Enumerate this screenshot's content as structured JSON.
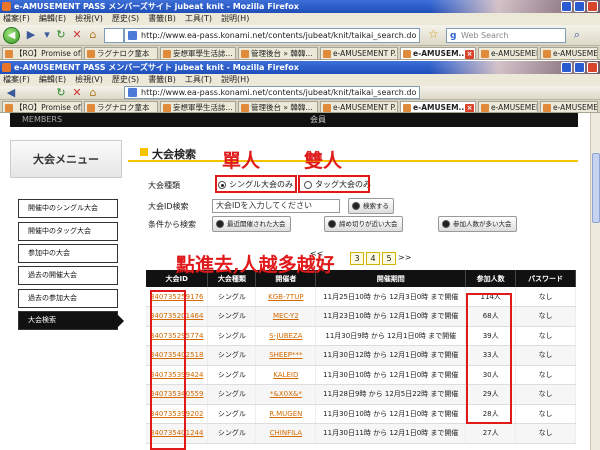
{
  "window": {
    "title": "e-AMUSEMENT PASS メンバーズサイト jubeat knit - Mozilla Firefox",
    "menu": [
      "檔案(F)",
      "編輯(E)",
      "檢視(V)",
      "歷史(S)",
      "書籤(B)",
      "工具(T)",
      "說明(H)"
    ],
    "nav": {
      "favicon_domain": "konami.net",
      "url": "http://www.ea-pass.konami.net/contents/jubeat/knit/taikai_search.do",
      "search_placeholder": "Web Search"
    },
    "tabs": [
      {
        "label": "【RO】Promise of..."
      },
      {
        "label": "ラグナロク童本"
      },
      {
        "label": "妄想軍學生活誌..."
      },
      {
        "label": "管理後台 » 韓韓..."
      },
      {
        "label": "e-AMUSEMENT P..."
      },
      {
        "label": "e-AMUSEM..."
      },
      {
        "label": "e-AMUSEMENT P..."
      },
      {
        "label": "e-AMUSEMENT P..."
      },
      {
        "label": "e-AMUSEMENT..."
      }
    ]
  },
  "window2": {
    "title": "e-AMUSEMENT PASS メンバーズサイト jubeat knit - Mozilla Firefox",
    "menu": [
      "檔案(F)",
      "編輯(E)",
      "檢視(V)",
      "歷史(S)",
      "書籤(B)",
      "工具(T)",
      "說明(H)"
    ],
    "nav": {
      "favicon_domain": "konami.net",
      "url": "http://www.ea-pass.konami.net/contents/jubeat/knit/taikai_search.do"
    },
    "tabs": [
      {
        "label": "【RO】Promise of..."
      },
      {
        "label": "ラグナロク童本"
      },
      {
        "label": "妄想軍學生活誌..."
      },
      {
        "label": "管理後台 » 韓韓..."
      },
      {
        "label": "e-AMUSEMENT P..."
      },
      {
        "label": "e-AMUSEM..."
      },
      {
        "label": "e-AMUSEMENT P..."
      },
      {
        "label": "e-AMUSEMENT P..."
      },
      {
        "label": "e-AMUSEMENT..."
      }
    ]
  },
  "banner_text": "MEMBERS",
  "banner_text2": "会員",
  "sidebar": {
    "heading": "大会メニュー",
    "items": [
      {
        "label": "開催中のシングル大会"
      },
      {
        "label": "開催中のタッグ大会"
      },
      {
        "label": "参加中の大会"
      },
      {
        "label": "過去の開催大会"
      },
      {
        "label": "過去の参加大会"
      },
      {
        "label": "大会検索"
      }
    ]
  },
  "search": {
    "title": "大会検索",
    "type_label": "大会種類",
    "single_option": "シングル大会のみ",
    "tag_option": "タッグ大会のみ",
    "id_label": "大会ID検索",
    "id_placeholder": "大会IDを入力してください",
    "search_button": "検索する",
    "cond_label": "条件から検索",
    "cond_buttons": [
      "最近開催された大会",
      "締め切りが近い大会",
      "参加人数が多い大会"
    ]
  },
  "annotations": {
    "single": "單人",
    "tag": "雙人",
    "click": "點進去,人越多越好"
  },
  "pagination": {
    "prev": "<<",
    "pages": [
      "3",
      "4",
      "5"
    ],
    "next": ">>"
  },
  "table": {
    "headers": [
      "大会ID",
      "大会種類",
      "開催者",
      "開催期間",
      "参加人数",
      "パスワード"
    ],
    "rows": [
      {
        "id": "340735259176",
        "type": "シングル",
        "host": "KGB-7TUP",
        "period": "11月25日10時 から 12月3日0時 まで開催",
        "count": "114人",
        "pw": "なし"
      },
      {
        "id": "340735201464",
        "type": "シングル",
        "host": "MEC-Y2",
        "period": "11月23日10時 から 12月1日0時 まで開催",
        "count": "68人",
        "pw": "なし"
      },
      {
        "id": "340735295774",
        "type": "シングル",
        "host": "S-JUBEZA",
        "period": "11月30日9時 から 12月1日0時 まで開催",
        "count": "39人",
        "pw": "なし"
      },
      {
        "id": "340735402518",
        "type": "シングル",
        "host": "SHEEP***",
        "period": "11月30日12時 から 12月1日0時 まで開催",
        "count": "33人",
        "pw": "なし"
      },
      {
        "id": "340735399424",
        "type": "シングル",
        "host": "KALEID",
        "period": "11月30日10時 から 12月1日0時 まで開催",
        "count": "30人",
        "pw": "なし"
      },
      {
        "id": "340735340559",
        "type": "シングル",
        "host": "*&X0X&*",
        "period": "11月28日9時 から 12月5日22時 まで開催",
        "count": "29人",
        "pw": "なし"
      },
      {
        "id": "340735399202",
        "type": "シングル",
        "host": "R.MUGEN",
        "period": "11月30日10時 から 12月1日0時 まで開催",
        "count": "28人",
        "pw": "なし"
      },
      {
        "id": "340735401244",
        "type": "シングル",
        "host": "CHINFILA",
        "period": "11月30日11時 から 12月1日0時 まで開催",
        "count": "27人",
        "pw": "なし"
      }
    ]
  }
}
